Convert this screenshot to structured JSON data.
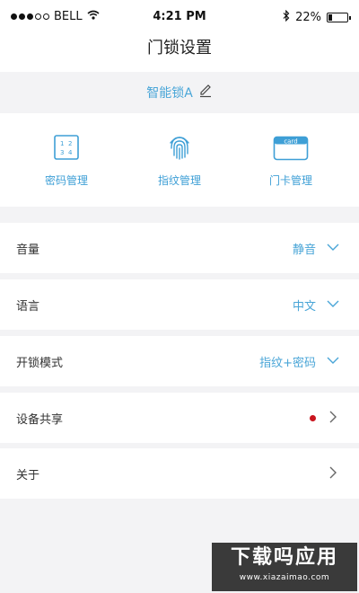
{
  "status_bar": {
    "carrier": "BELL",
    "time": "4:21 PM",
    "battery": "22%",
    "battery_level": 0.22,
    "signal_icon": "signal-dots-icon",
    "wifi_icon": "wifi-icon",
    "bluetooth_icon": "bluetooth-icon",
    "battery_icon": "battery-icon"
  },
  "nav": {
    "title": "门锁设置"
  },
  "lock": {
    "name": "智能锁A",
    "edit_icon": "pencil-icon"
  },
  "features": [
    {
      "label": "密码管理",
      "icon": "keypad-icon"
    },
    {
      "label": "指纹管理",
      "icon": "fingerprint-icon"
    },
    {
      "label": "门卡管理",
      "icon": "card-icon",
      "icon_text": "card"
    }
  ],
  "settings": [
    {
      "label": "音量",
      "value": "静音",
      "control": "dropdown"
    },
    {
      "label": "语言",
      "value": "中文",
      "control": "dropdown"
    },
    {
      "label": "开锁模式",
      "value": "指纹+密码",
      "control": "dropdown"
    },
    {
      "label": "设备共享",
      "value": "",
      "control": "link",
      "badge": "red-dot"
    },
    {
      "label": "关于",
      "value": "",
      "control": "link"
    }
  ],
  "watermark": {
    "title": "下载吗应用",
    "url": "www.xiazaimao.com"
  },
  "colors": {
    "accent": "#49a5d7",
    "badge": "#c9151e",
    "background": "#f3f3f5"
  }
}
